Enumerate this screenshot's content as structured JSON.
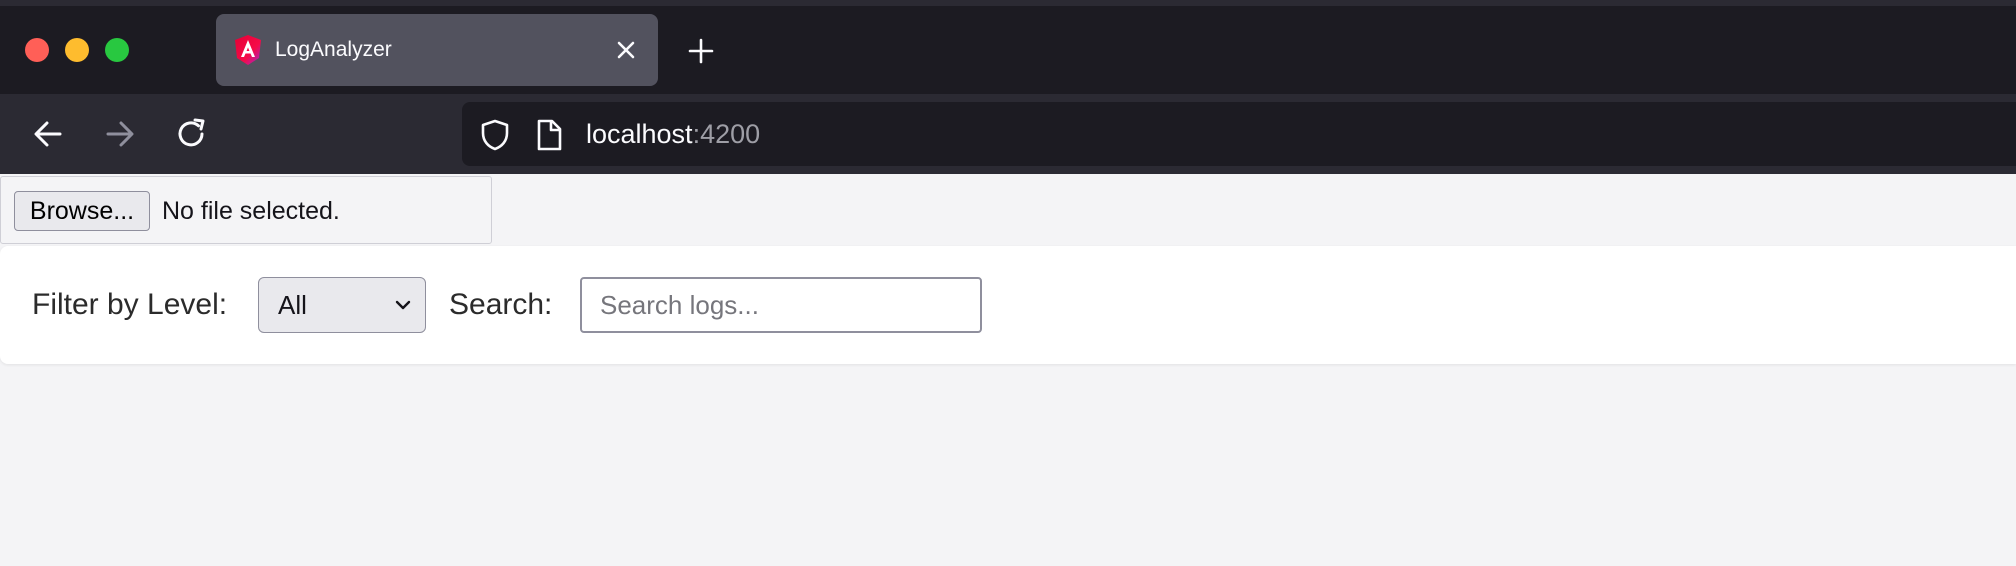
{
  "browser": {
    "tab": {
      "title": "LogAnalyzer",
      "favicon": "angular-logo-icon"
    },
    "url": {
      "host": "localhost",
      "port": ":4200"
    },
    "icons": {
      "back": "arrow-left-icon",
      "forward": "arrow-right-icon",
      "reload": "reload-icon",
      "shield": "shield-icon",
      "page": "page-icon",
      "close_tab": "close-icon",
      "new_tab": "plus-icon"
    },
    "colors": {
      "tabstrip_bg": "#1c1b22",
      "toolbar_bg": "#2b2a33",
      "active_tab_bg": "#52525e",
      "close_red": "#ff5f57",
      "minimize_yellow": "#febc2e",
      "maximize_green": "#28c840"
    }
  },
  "file_upload": {
    "button_label": "Browse...",
    "status": "No file selected."
  },
  "filters": {
    "level_label": "Filter by Level:",
    "level_selected": "All",
    "search_label": "Search:",
    "search_placeholder": "Search logs...",
    "search_value": ""
  }
}
